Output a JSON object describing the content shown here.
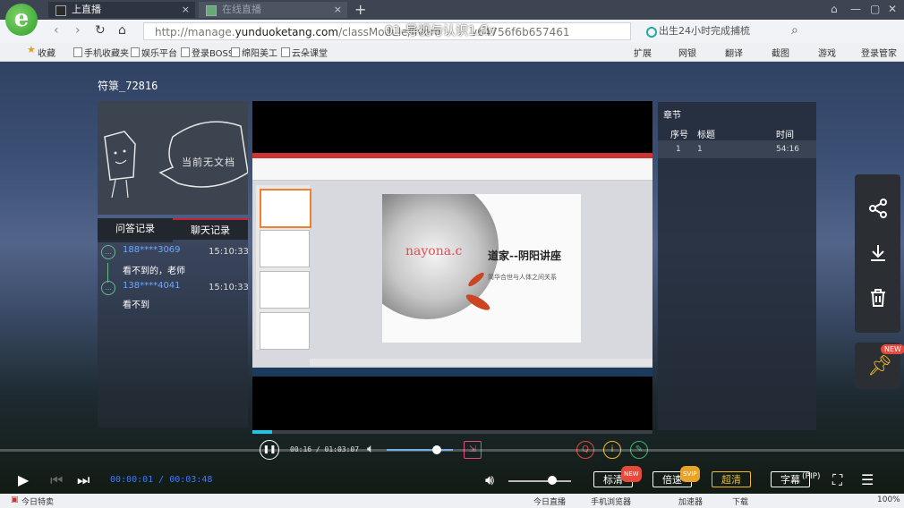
{
  "browser": {
    "logo": "e",
    "tabs": [
      {
        "label": "上直播"
      },
      {
        "label": "在线直播"
      }
    ],
    "newtab": "+",
    "url_prefix": "http://manage.",
    "url_domain": "yunduoketang.com",
    "url_rest": "/classModule/livero",
    "url_tail": "v64756f6b657461",
    "search_text": "出生24小时完成捕梳",
    "video_title": "01-导视与认识1.flv",
    "bookmarks": [
      "收藏",
      "手机收藏夹",
      "娱乐平台",
      "登录BOSS",
      "绵阳美工",
      "云朵课堂"
    ],
    "bookmarks_right": [
      "扩展",
      "网银",
      "翻译",
      "截图",
      "游戏",
      "登录管家"
    ]
  },
  "course": {
    "username": "符箓_72816",
    "doc_empty": "当前无文档",
    "tabs": [
      "问答记录",
      "聊天记录"
    ],
    "messages": [
      {
        "user": "188****3069",
        "time": "15:10:33",
        "text": "看不到的，老师"
      },
      {
        "user": "138****4041",
        "time": "15:10:33",
        "text": "看不到"
      }
    ],
    "slide": {
      "title": "道家--阴阳讲座",
      "subtitle": "简华合世与人体之间关系",
      "watermark": "nayona.c"
    },
    "video_time": "00:16 / 01:03:07",
    "video_progress": 0.05,
    "video_volume": 0.75
  },
  "chapters": {
    "header": "章节",
    "columns": [
      "序号",
      "标题",
      "时间"
    ],
    "rows": [
      {
        "index": "1",
        "title": "1",
        "time": "54:16"
      }
    ]
  },
  "sidebar": {
    "new_badge": "NEW"
  },
  "player": {
    "time": "00:00:01 / 00:03:48",
    "volume": 0.7,
    "buttons": [
      {
        "label": "标清",
        "badge": "NEW"
      },
      {
        "label": "倍速",
        "badge": "SVIP"
      },
      {
        "label": "超清",
        "badge": ""
      },
      {
        "label": "字幕",
        "badge": ""
      }
    ],
    "extra_label": "(PIP)"
  },
  "statusbar": {
    "left": "今日特卖",
    "items": [
      "今日直播",
      "手机浏览器",
      "加速器",
      "下载"
    ],
    "zoom": "100%"
  }
}
